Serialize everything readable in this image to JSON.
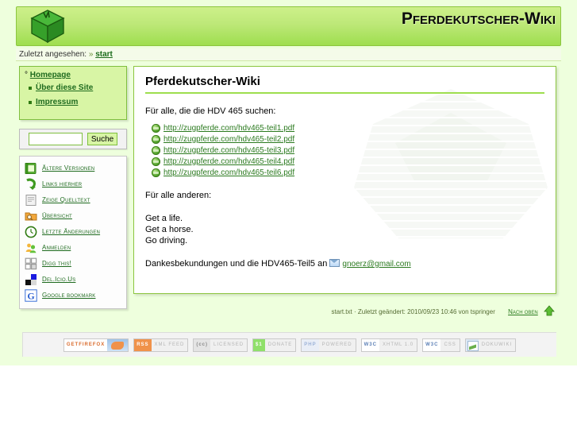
{
  "header": {
    "title": "Pferdekutscher-Wiki",
    "logo_icon": "green-cube-logo"
  },
  "breadcrumbs": {
    "label": "Zuletzt angesehen:",
    "separator": "»",
    "items": [
      {
        "label": "start"
      }
    ]
  },
  "sidebar": {
    "nav": {
      "home": {
        "label": "Homepage",
        "bullet": "°"
      },
      "items": [
        {
          "label": "Über diese Site"
        },
        {
          "label": "Impressum"
        }
      ]
    },
    "search": {
      "value": "",
      "placeholder": "",
      "button_label": "Suche"
    },
    "tools": [
      {
        "label": "Ältere Versionen",
        "icon": "book-icon"
      },
      {
        "label": "Links hierher",
        "icon": "backlink-arrow-icon"
      },
      {
        "label": "Zeige Quelltext",
        "icon": "source-page-icon"
      },
      {
        "label": "Übersicht",
        "icon": "folder-search-icon"
      },
      {
        "label": "Letzte Änderungen",
        "icon": "clock-icon"
      },
      {
        "label": "Anmelden",
        "icon": "users-login-icon"
      },
      {
        "label": "Digg this!",
        "icon": "digg-icon"
      },
      {
        "label": "Del.Icio.Us",
        "icon": "delicious-squares-icon"
      },
      {
        "label": "Google bookmark",
        "icon": "google-g-icon"
      }
    ]
  },
  "content": {
    "title": "Pferdekutscher-Wiki",
    "intro": "Für alle, die die HDV 465 suchen:",
    "links": [
      {
        "label": "http://zugpferde.com/hdv465-teil1.pdf",
        "icon": "external-link-icon"
      },
      {
        "label": "http://zugpferde.com/hdv465-teil2.pdf",
        "icon": "external-link-icon"
      },
      {
        "label": "http://zugpferde.com/hdv465-teil3.pdf",
        "icon": "external-link-icon"
      },
      {
        "label": "http://zugpferde.com/hdv465-teil4.pdf",
        "icon": "external-link-icon"
      },
      {
        "label": "http://zugpferde.com/hdv465-teil6.pdf",
        "icon": "external-link-icon"
      }
    ],
    "others_heading": "Für alle anderen:",
    "lines": "Get a life.\nGet a horse.\nGo driving.",
    "thanks_prefix": "Dankesbekundungen und die HDV465-Teil5 an",
    "email": "gnoerz@gmail.com",
    "email_icon": "mail-icon",
    "watermark_icon": "dokuwiki-watermark"
  },
  "docinfo": {
    "text": "start.txt · Zuletzt geändert: 2010/09/23 10:46 von tspringer",
    "back_to_top": "Nach oben",
    "top_icon": "arrow-up-icon"
  },
  "badges": [
    {
      "name": "getfirefox",
      "left": "GETFIREFOX",
      "right": ""
    },
    {
      "name": "rss-xml-feed",
      "left": "RSS",
      "right": "XML FEED"
    },
    {
      "name": "cc-licensed",
      "left": "(cc)",
      "right": "LICENSED"
    },
    {
      "name": "donate",
      "left": "$1",
      "right": "DONATE"
    },
    {
      "name": "php-powered",
      "left": "PHP",
      "right": "POWERED"
    },
    {
      "name": "valid-xhtml",
      "left": "W3C",
      "right": "XHTML 1.0"
    },
    {
      "name": "valid-css",
      "left": "W3C",
      "right": "CSS"
    },
    {
      "name": "driven-by-dokuwiki",
      "left": "",
      "right": "DOKUWIKI"
    }
  ],
  "colors": {
    "accent": "#9ede4e",
    "page_bg": "#eeffdd",
    "link": "#2b7a1f",
    "sidebar_bg": "#d8f5a5"
  }
}
